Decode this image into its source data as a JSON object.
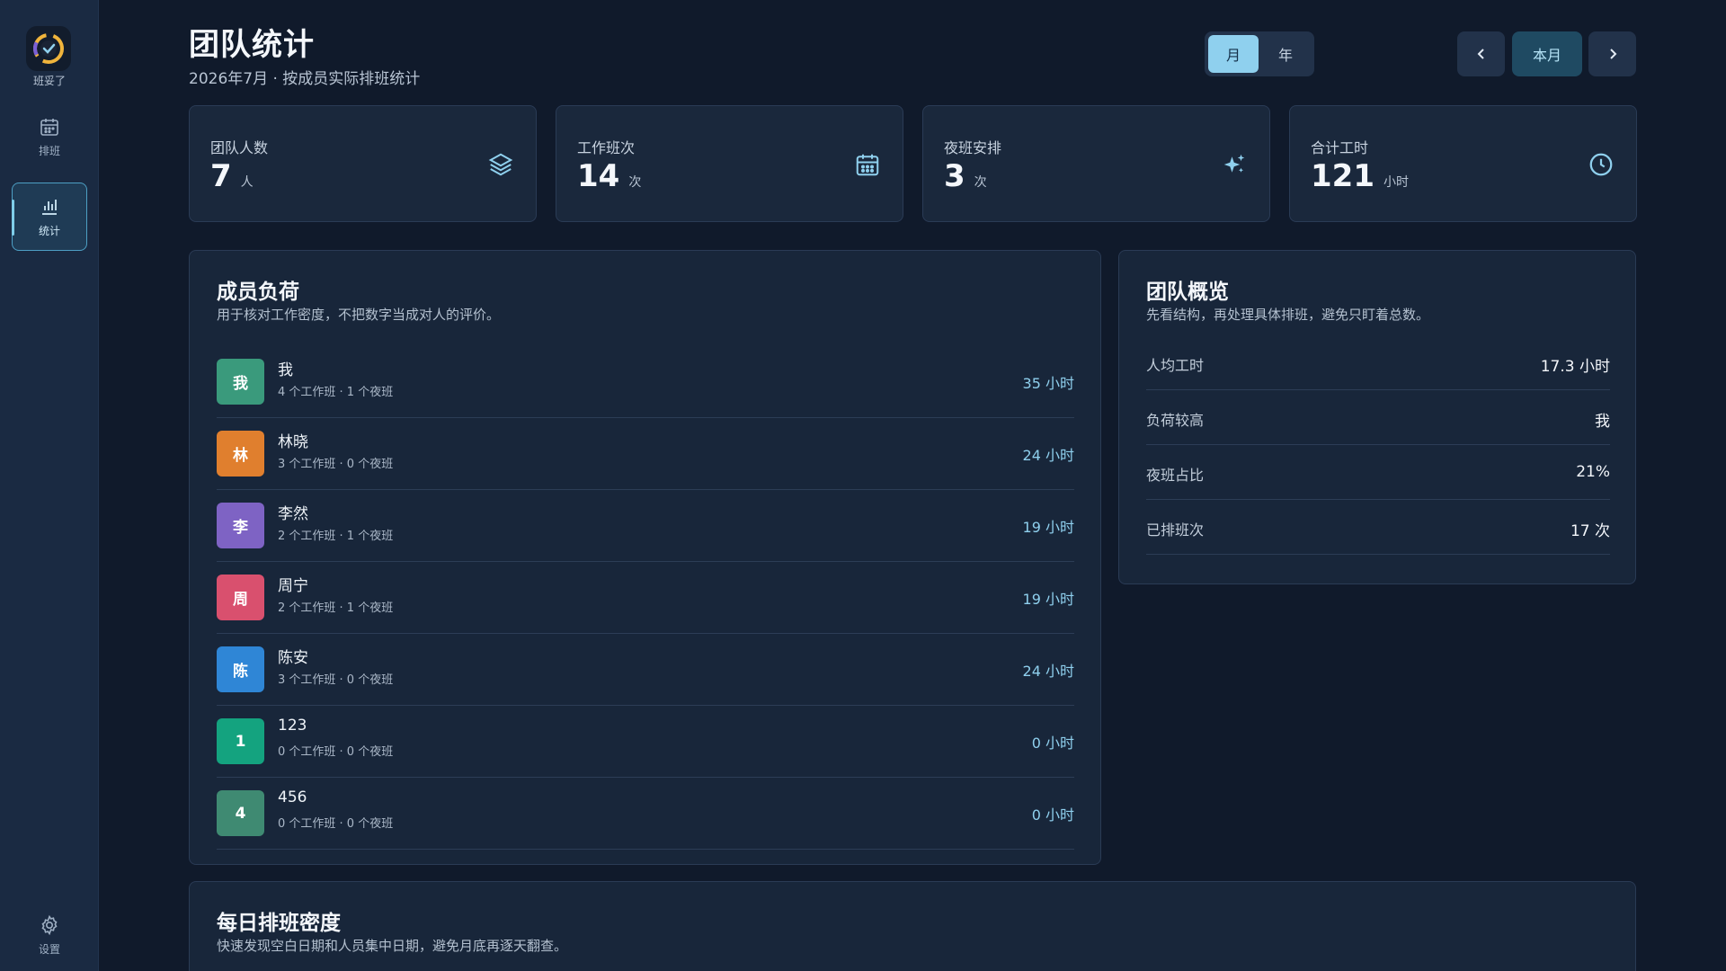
{
  "app": {
    "name": "班妥了"
  },
  "sidebar": {
    "items": [
      {
        "label": "排班",
        "icon": "calendar-icon"
      },
      {
        "label": "统计",
        "icon": "bar-chart-icon",
        "active": true
      },
      {
        "label": "设置",
        "icon": "gear-icon"
      }
    ]
  },
  "header": {
    "title": "团队统计",
    "subtitle": "2026年7月 · 按成员实际排班统计",
    "period_toggle": {
      "month": "月",
      "year": "年",
      "selected": "月"
    },
    "prev_icon": "chevron-left-icon",
    "current_label": "本月",
    "next_icon": "chevron-right-icon"
  },
  "stats": [
    {
      "label": "团队人数",
      "value": "7",
      "unit": "人",
      "icon": "layers-icon"
    },
    {
      "label": "工作班次",
      "value": "14",
      "unit": "次",
      "icon": "calendar-icon"
    },
    {
      "label": "夜班安排",
      "value": "3",
      "unit": "次",
      "icon": "sparkles-icon"
    },
    {
      "label": "合计工时",
      "value": "121",
      "unit": "小时",
      "icon": "clock-icon"
    }
  ],
  "members_panel": {
    "title": "成员负荷",
    "description": "用于核对工作密度，不把数字当成对人的评价。",
    "members": [
      {
        "initial": "我",
        "name": "我",
        "detail": "4 个工作班 · 1 个夜班",
        "hours": "35 小时",
        "color": "#3a9a7c"
      },
      {
        "initial": "林",
        "name": "林晓",
        "detail": "3 个工作班 · 0 个夜班",
        "hours": "24 小时",
        "color": "#e07f2e"
      },
      {
        "initial": "李",
        "name": "李然",
        "detail": "2 个工作班 · 1 个夜班",
        "hours": "19 小时",
        "color": "#7e63c4"
      },
      {
        "initial": "周",
        "name": "周宁",
        "detail": "2 个工作班 · 1 个夜班",
        "hours": "19 小时",
        "color": "#d9506e"
      },
      {
        "initial": "陈",
        "name": "陈安",
        "detail": "3 个工作班 · 0 个夜班",
        "hours": "24 小时",
        "color": "#2f86d6"
      },
      {
        "initial": "1",
        "name": "123",
        "detail": "0 个工作班 · 0 个夜班",
        "hours": "0 小时",
        "color": "#14a37f"
      },
      {
        "initial": "4",
        "name": "456",
        "detail": "0 个工作班 · 0 个夜班",
        "hours": "0 小时",
        "color": "#3f8a72"
      }
    ]
  },
  "overview_panel": {
    "title": "团队概览",
    "description": "先看结构，再处理具体排班，避免只盯着总数。",
    "rows": [
      {
        "label": "人均工时",
        "value": "17.3 小时"
      },
      {
        "label": "负荷较高",
        "value": "我"
      },
      {
        "label": "夜班占比",
        "value": "21%"
      },
      {
        "label": "已排班次",
        "value": "17 次"
      }
    ]
  },
  "density_panel": {
    "title": "每日排班密度",
    "description": "快速发现空白日期和人员集中日期，避免月底再逐天翻查。"
  },
  "colors": {
    "accent": "#8fd0ee",
    "background": "#101a2b",
    "sidebar": "#1a2a42",
    "card": "#1a283c"
  }
}
